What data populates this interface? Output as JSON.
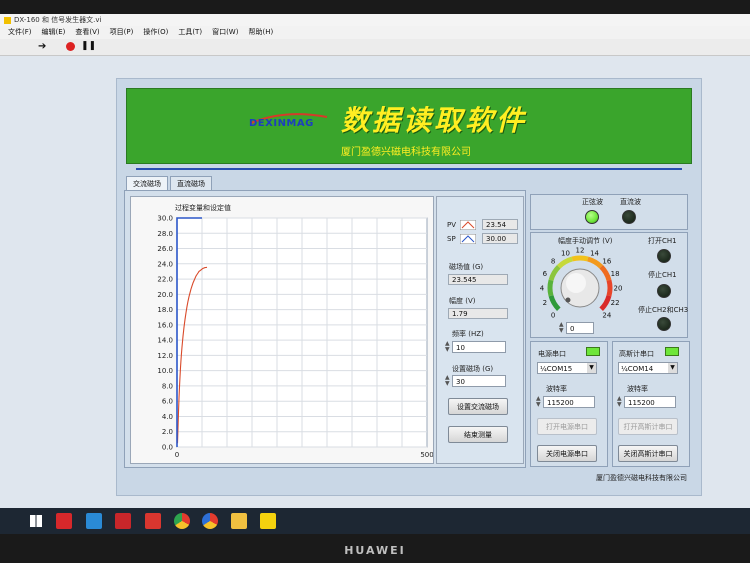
{
  "window": {
    "title": "DX-160 和 信号发生器文.vi",
    "menu": [
      "文件(F)",
      "编辑(E)",
      "查看(V)",
      "项目(P)",
      "操作(O)",
      "工具(T)",
      "窗口(W)",
      "帮助(H)"
    ]
  },
  "banner": {
    "logo": "DEXINMAG",
    "title": "数据读取软件",
    "company": "厦门盈德兴磁电科技有限公司"
  },
  "tabs": [
    "交流磁场",
    "直流磁场"
  ],
  "chart_data": {
    "type": "line",
    "title": "过程变量和设定值",
    "xlim": [
      0,
      500
    ],
    "ylim": [
      0,
      30
    ],
    "x_ticks": [
      "0",
      "500"
    ],
    "y_ticks": [
      "0.0",
      "2.0",
      "4.0",
      "6.0",
      "8.0",
      "10.0",
      "12.0",
      "14.0",
      "16.0",
      "18.0",
      "20.0",
      "22.0",
      "24.0",
      "26.0",
      "28.0",
      "30.0"
    ],
    "series": [
      {
        "name": "PV",
        "color": "#d94a2a",
        "x": [
          1,
          2,
          3,
          4,
          5,
          6,
          7,
          8,
          9,
          10,
          12,
          14,
          16,
          18,
          20,
          22,
          24,
          26,
          28,
          30,
          32,
          34,
          36,
          38,
          40,
          42,
          44,
          46,
          48,
          50,
          52,
          54,
          56,
          58,
          60
        ],
        "y": [
          0.5,
          2.5,
          4.6,
          6.4,
          7.9,
          9.2,
          10.4,
          11.4,
          12.3,
          13.1,
          14.5,
          15.7,
          16.7,
          17.6,
          18.4,
          19.1,
          19.7,
          20.2,
          20.7,
          21.1,
          21.5,
          21.8,
          22.1,
          22.4,
          22.6,
          22.8,
          23.0,
          23.1,
          23.2,
          23.3,
          23.4,
          23.45,
          23.5,
          23.52,
          23.54
        ]
      },
      {
        "name": "SP",
        "color": "#2b57c9",
        "x": [
          0,
          0,
          1,
          50
        ],
        "y": [
          0,
          30,
          30,
          30
        ]
      }
    ]
  },
  "side": {
    "pv_label": "PV",
    "pv_value": "23.54",
    "sp_label": "SP",
    "sp_value": "30.00",
    "field_label": "磁场值 (G)",
    "field_value": "23.545",
    "amp_label": "幅度 (V)",
    "amp_value": "1.79",
    "freq_label": "频率 (HZ)",
    "freq_value": "10",
    "setfield_label": "设置磁场 (G)",
    "setfield_value": "30",
    "btn_set": "设置交流磁场",
    "btn_end": "结束测量"
  },
  "right": {
    "sine_label": "正弦波",
    "dc_label": "直流波",
    "knob_label": "幅度手动调节 (V)",
    "knob_ticks": [
      "0",
      "2",
      "4",
      "6",
      "8",
      "10",
      "12",
      "14",
      "16",
      "18",
      "20",
      "22",
      "24"
    ],
    "knob_value": "0",
    "ch1_open": "打开CH1",
    "ch1_stop": "停止CH1",
    "ch23_stop": "停止CH2和CH3",
    "power_port_title": "电源串口",
    "power_port": "COM15",
    "power_baud_label": "波特率",
    "power_baud": "115200",
    "power_open": "打开电源串口",
    "power_close": "关闭电源串口",
    "gauss_port_title": "高斯计串口",
    "gauss_port": "COM14",
    "gauss_baud_label": "波特率",
    "gauss_baud": "115200",
    "gauss_open": "打开高斯计串口",
    "gauss_close": "关闭高斯计串口",
    "footer": "厦门盈德兴磁电科技有限公司"
  },
  "colors": {
    "banner_green": "#3aa52c",
    "title_yellow": "#ffee22",
    "led_on": "#6ee63a",
    "led_off": "#1d2a1d"
  },
  "device": {
    "brand": "HUAWEI"
  }
}
